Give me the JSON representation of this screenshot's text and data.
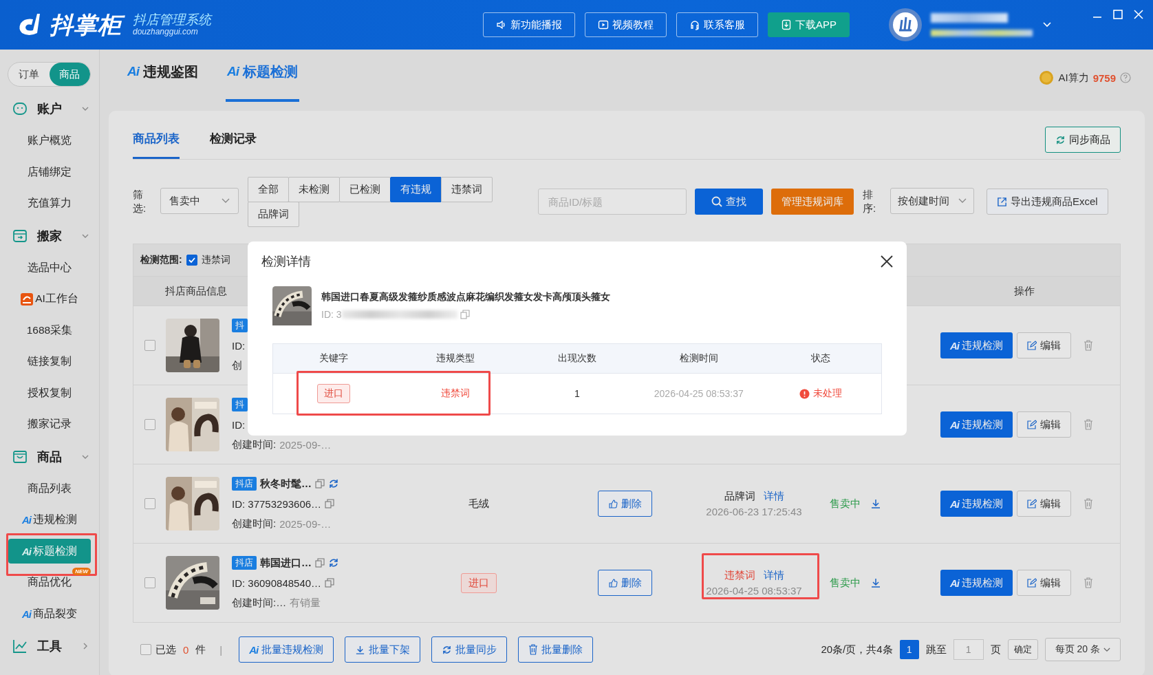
{
  "app": {
    "name": "抖掌柜",
    "tagline": "抖店管理系统",
    "site": "douzhanggui.com"
  },
  "header_buttons": [
    {
      "label": "新功能播报",
      "kind": "speaker"
    },
    {
      "label": "视频教程",
      "kind": "video"
    },
    {
      "label": "联系客服",
      "kind": "headset"
    },
    {
      "label": "下载APP",
      "kind": "download"
    }
  ],
  "mode_switch": [
    {
      "label": "订单",
      "selected": false
    },
    {
      "label": "商品",
      "selected": true
    }
  ],
  "sidebar": [
    {
      "label": "账户",
      "kind": "account",
      "expanded": true,
      "children": [
        {
          "label": "账户概览",
          "kind": "plain",
          "selected": false
        },
        {
          "label": "店铺绑定",
          "kind": "plain",
          "selected": false
        },
        {
          "label": "充值算力",
          "kind": "plain",
          "selected": false
        }
      ]
    },
    {
      "label": "搬家",
      "kind": "move",
      "expanded": true,
      "children": [
        {
          "label": "选品中心",
          "kind": "plain",
          "selected": false
        },
        {
          "label": "AI工作台",
          "kind": "logo",
          "selected": false
        },
        {
          "label": "1688采集",
          "kind": "plain",
          "selected": false
        },
        {
          "label": "链接复制",
          "kind": "plain",
          "selected": false
        },
        {
          "label": "授权复制",
          "kind": "plain",
          "selected": false
        },
        {
          "label": "搬家记录",
          "kind": "plain",
          "selected": false
        }
      ]
    },
    {
      "label": "商品",
      "kind": "goods",
      "expanded": true,
      "children": [
        {
          "label": "商品列表",
          "kind": "plain",
          "selected": false
        },
        {
          "label": "违规检测",
          "kind": "ai",
          "prefix": "Ai",
          "selected": false
        },
        {
          "label": "标题检测",
          "kind": "ai",
          "prefix": "Ai",
          "selected": true,
          "highlighted": true
        },
        {
          "label": "商品优化",
          "kind": "plain",
          "badge": "NEW",
          "selected": false
        },
        {
          "label": "商品裂变",
          "kind": "ai",
          "prefix": "Ai",
          "selected": false
        }
      ]
    },
    {
      "label": "工具",
      "kind": "tools",
      "expanded": false
    }
  ],
  "top_tabs": [
    {
      "prefix": "Ai",
      "label": "违规鉴图",
      "selected": false
    },
    {
      "prefix": "Ai",
      "label": "标题检测",
      "selected": true
    }
  ],
  "ai_power": {
    "label": "AI算力",
    "value": "9759"
  },
  "panel_tabs": [
    {
      "label": "商品列表",
      "selected": true
    },
    {
      "label": "检测记录",
      "selected": false
    }
  ],
  "sync_button": "同步商品",
  "filter": {
    "label": "筛选:",
    "status": "售卖中",
    "segments": [
      {
        "label": "全部",
        "selected": false
      },
      {
        "label": "未检测",
        "selected": false
      },
      {
        "label": "已检测",
        "selected": false
      },
      {
        "label": "有违规",
        "selected": true
      },
      {
        "label": "违禁词",
        "selected": false
      },
      {
        "label": "品牌词",
        "selected": false
      }
    ],
    "search_placeholder": "商品ID/标题",
    "search_button": "查找",
    "manage_button": "管理违规词库",
    "sort_label": "排序:",
    "sort": "按创建时间",
    "export_button": "导出违规商品Excel"
  },
  "scope": {
    "label": "检测范围:",
    "options": [
      {
        "label": "违禁词",
        "checked": true
      }
    ]
  },
  "table": {
    "columns": [
      "抖店商品信息",
      "操作"
    ],
    "rows": [
      {
        "checked": false,
        "badge": "抖",
        "id": "ID:",
        "created_label": "创",
        "actions": {
          "prefix": "Ai",
          "check": "违规检测",
          "edit": "编辑"
        }
      },
      {
        "checked": false,
        "badge": "抖",
        "id": "ID:",
        "created_label": "创建时间:",
        "created_value": "2025-09-…",
        "actions": {
          "prefix": "Ai",
          "check": "违规检测",
          "edit": "编辑"
        }
      },
      {
        "checked": false,
        "badge": "抖店",
        "title": "秋冬时髦…",
        "id": "ID: 37753293606…",
        "created_label": "创建时间:",
        "created_value": "2025-09-…",
        "keyword": {
          "text": "毛绒",
          "kind": "plain"
        },
        "delete": "删除",
        "violation": {
          "text": "品牌词",
          "kind": "brand"
        },
        "detail": "详情",
        "time": "2026-06-23 17:25:43",
        "status": "售卖中",
        "actions": {
          "prefix": "Ai",
          "check": "违规检测",
          "edit": "编辑"
        }
      },
      {
        "checked": false,
        "badge": "抖店",
        "title": "韩国进口…",
        "id": "ID: 36090848540…",
        "created_label": "创建时间:…",
        "created_value": "有销量",
        "keyword": {
          "text": "进口",
          "kind": "tag"
        },
        "delete": "删除",
        "violation": {
          "text": "违禁词",
          "kind": "banned"
        },
        "detail": "详情",
        "time": "2026-04-25 08:53:37",
        "status": "售卖中",
        "highlighted": true,
        "actions": {
          "prefix": "Ai",
          "check": "违规检测",
          "edit": "编辑"
        }
      }
    ]
  },
  "footer": {
    "select_label": "已选",
    "checked": false,
    "count": "0",
    "unit": "件",
    "separator": "|",
    "batch": [
      {
        "prefix": "Ai",
        "label": "批量违规检测",
        "kind": "ai"
      },
      {
        "label": "批量下架",
        "kind": "down"
      },
      {
        "label": "批量同步",
        "kind": "sync"
      },
      {
        "label": "批量删除",
        "kind": "delete"
      }
    ],
    "summary": "20条/页，共4条",
    "pages": [
      {
        "label": "1",
        "selected": true
      }
    ],
    "jump_label": "跳至",
    "jump_value": "1",
    "page_unit": "页",
    "confirm": "确定",
    "per_page": "每页 20 条"
  },
  "dialog": {
    "title": "检测详情",
    "product_title": "韩国进口春夏高级发箍纱质感波点麻花编织发箍女发卡高颅顶头箍女",
    "product_id": "ID: 3",
    "columns": [
      "关键字",
      "违规类型",
      "出现次数",
      "检测时间",
      "状态"
    ],
    "rows": [
      {
        "keyword": "进口",
        "type": "违禁词",
        "count": "1",
        "time": "2026-04-25 08:53:37",
        "status": "未处理",
        "highlighted": true
      }
    ]
  }
}
